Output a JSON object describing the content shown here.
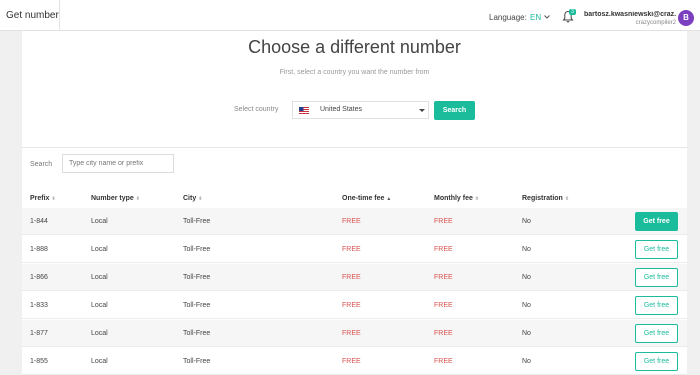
{
  "header": {
    "app_title": "Get number",
    "language_label": "Language:",
    "language_value": "EN",
    "notification_count": "3",
    "user_email": "bartosz.kwasniewski@craz...",
    "user_sub": "crazycompiler2",
    "avatar_letter": "B",
    "avatar_color": "#7b3fbf"
  },
  "picker": {
    "title": "Choose a different number",
    "subtitle": "First, select a country you want the number from",
    "country_label": "Select country",
    "country_value": "United States",
    "search_label": "Search"
  },
  "table": {
    "search_label": "Search",
    "search_placeholder": "Type city name or prefix",
    "columns": [
      "Prefix",
      "Number type",
      "City",
      "One-time fee",
      "Monthly fee",
      "Registration"
    ],
    "rows": [
      {
        "prefix": "1-844",
        "type": "Local",
        "city": "Toll-Free",
        "onetime": "FREE",
        "monthly": "FREE",
        "registration": "No",
        "action": "Get free"
      },
      {
        "prefix": "1-888",
        "type": "Local",
        "city": "Toll-Free",
        "onetime": "FREE",
        "monthly": "FREE",
        "registration": "No",
        "action": "Get free"
      },
      {
        "prefix": "1-866",
        "type": "Local",
        "city": "Toll-Free",
        "onetime": "FREE",
        "monthly": "FREE",
        "registration": "No",
        "action": "Get free"
      },
      {
        "prefix": "1-833",
        "type": "Local",
        "city": "Toll-Free",
        "onetime": "FREE",
        "monthly": "FREE",
        "registration": "No",
        "action": "Get free"
      },
      {
        "prefix": "1-877",
        "type": "Local",
        "city": "Toll-Free",
        "onetime": "FREE",
        "monthly": "FREE",
        "registration": "No",
        "action": "Get free"
      },
      {
        "prefix": "1-855",
        "type": "Local",
        "city": "Toll-Free",
        "onetime": "FREE",
        "monthly": "FREE",
        "registration": "No",
        "action": "Get free"
      }
    ]
  },
  "colors": {
    "accent": "#1abc9c",
    "free_text": "#d9534f",
    "page_bg": "#f0f0f1"
  },
  "icons": [
    "chevron-down-icon",
    "bell-icon",
    "us-flag-icon",
    "caret-down-icon",
    "sort-icon"
  ]
}
